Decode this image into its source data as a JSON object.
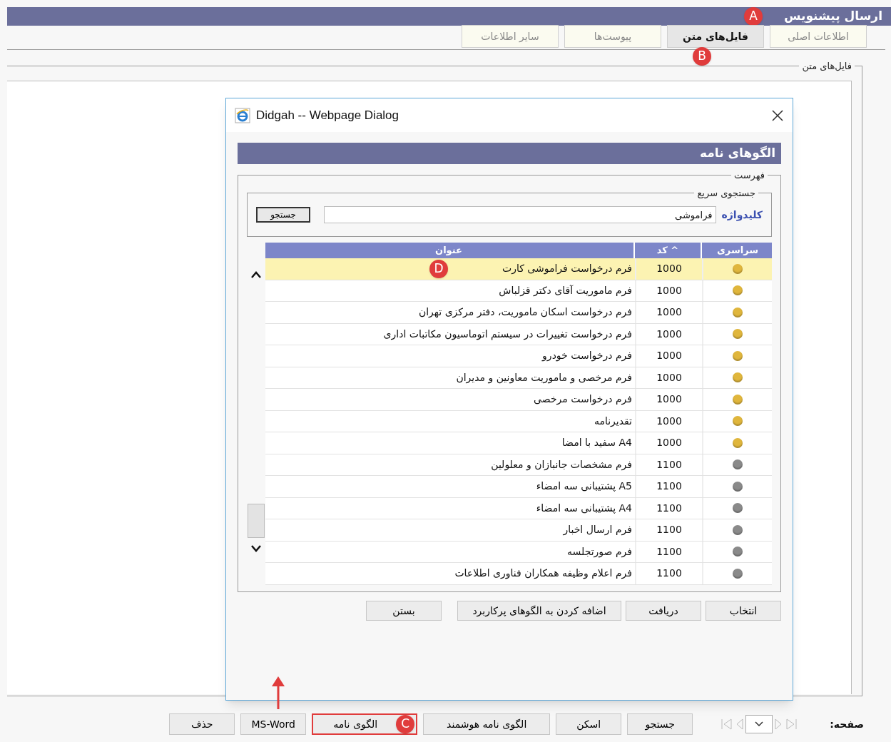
{
  "page_title": "ارسال پیشنویس",
  "callouts": [
    {
      "letter": "A"
    },
    {
      "letter": "B"
    },
    {
      "letter": "C"
    },
    {
      "letter": "D"
    }
  ],
  "tabs": [
    {
      "label": "اطلاعات اصلی",
      "selected": false
    },
    {
      "label": "فایل‌های متن",
      "selected": true
    },
    {
      "label": "پیوست‌ها",
      "selected": false
    },
    {
      "label": "سایر اطلاعات",
      "selected": false
    }
  ],
  "group_title": "فایل‌های متن",
  "dialog": {
    "title": "Didgah -- Webpage Dialog",
    "heading": "الگوهای نامه",
    "list_group": "فهرست",
    "search_group": "جستجوی سریع",
    "keyword_label": "کلیدواژه",
    "keyword_value": "فراموشی",
    "search_button": "جستجو",
    "columns": [
      "سراسری",
      "^ کد",
      "عنوان"
    ],
    "rows": [
      {
        "color": "#e0b63c",
        "code": "1000",
        "title": "فرم درخواست فراموشی کارت",
        "selected": true
      },
      {
        "color": "#e0b63c",
        "code": "1000",
        "title": "فرم ماموریت آقای دکتر قزلباش",
        "selected": false
      },
      {
        "color": "#e0b63c",
        "code": "1000",
        "title": "فرم درخواست اسکان ماموریت، دفتر مرکزی تهران",
        "selected": false
      },
      {
        "color": "#e0b63c",
        "code": "1000",
        "title": "فرم درخواست تغییرات در سیستم اتوماسیون مکاتبات اداری",
        "selected": false
      },
      {
        "color": "#e0b63c",
        "code": "1000",
        "title": "فرم درخواست خودرو",
        "selected": false
      },
      {
        "color": "#e0b63c",
        "code": "1000",
        "title": "فرم مرخصی و ماموریت معاونین و مدیران",
        "selected": false
      },
      {
        "color": "#e0b63c",
        "code": "1000",
        "title": "فرم درخواست مرخصی",
        "selected": false
      },
      {
        "color": "#e0b63c",
        "code": "1000",
        "title": "تقدیرنامه",
        "selected": false
      },
      {
        "color": "#e0b63c",
        "code": "1000",
        "title": "A4 سفید با امضا",
        "selected": false
      },
      {
        "color": "#8a8a8a",
        "code": "1100",
        "title": "فرم مشخصات جانبازان و معلولین",
        "selected": false
      },
      {
        "color": "#8a8a8a",
        "code": "1100",
        "title": "A5 پشتیبانی سه امضاء",
        "selected": false
      },
      {
        "color": "#8a8a8a",
        "code": "1100",
        "title": "A4 پشتیبانی سه امضاء",
        "selected": false
      },
      {
        "color": "#8a8a8a",
        "code": "1100",
        "title": "فرم ارسال اخبار",
        "selected": false
      },
      {
        "color": "#8a8a8a",
        "code": "1100",
        "title": "فرم صورتجلسه",
        "selected": false
      },
      {
        "color": "#8a8a8a",
        "code": "1100",
        "title": "فرم اعلام وظیفه همکاران فناوری اطلاعات",
        "selected": false
      }
    ],
    "buttons": [
      "انتخاب",
      "دریافت",
      "اضافه کردن به الگوهای پرکاربرد",
      "بستن"
    ]
  },
  "page_label": "صفحه:",
  "bottom_buttons": [
    {
      "label": "جستجو",
      "highlighted": false
    },
    {
      "label": "اسکن",
      "highlighted": false
    },
    {
      "label": "الگوی نامه هوشمند",
      "highlighted": false
    },
    {
      "label": "الگوی نامه",
      "highlighted": true
    },
    {
      "label": "MS-Word",
      "highlighted": false
    },
    {
      "label": "حذف",
      "highlighted": false
    }
  ]
}
